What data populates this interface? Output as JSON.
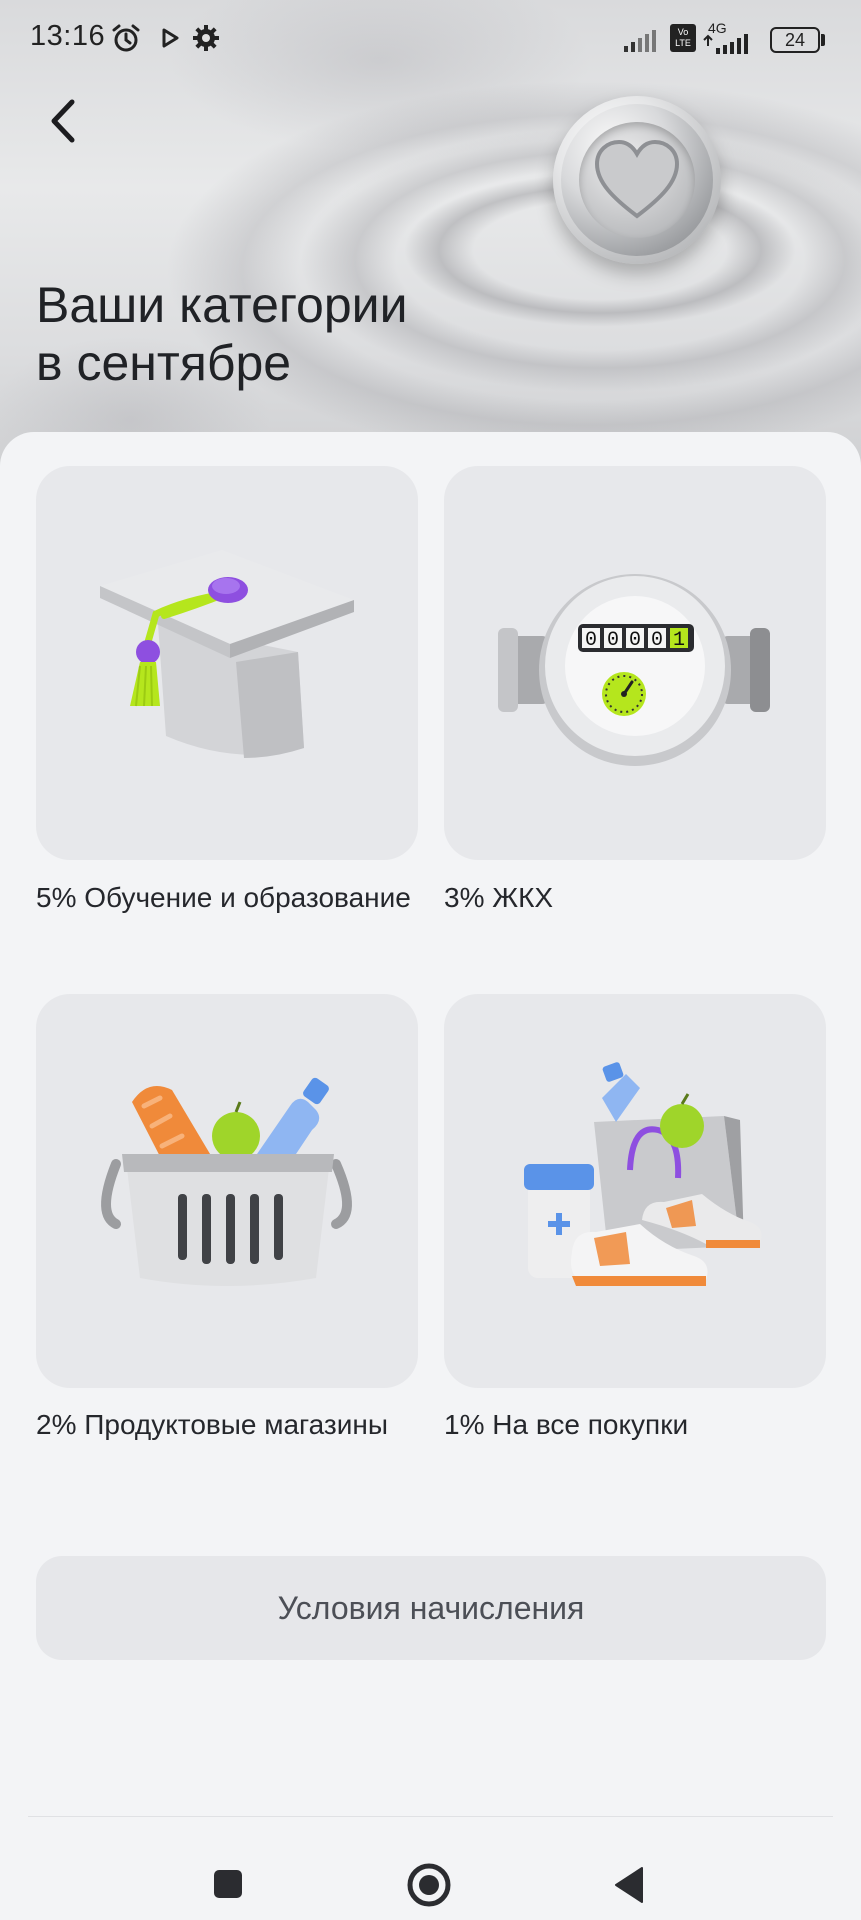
{
  "status_bar": {
    "time": "13:16",
    "battery": "24",
    "network": "4G",
    "volte": "Vo LTE"
  },
  "header": {
    "title_line1": "Ваши категории",
    "title_line2": "в сентябре"
  },
  "categories": [
    {
      "label": "5% Обучение и образование",
      "icon": "graduation-cap-icon"
    },
    {
      "label": "3% ЖКХ",
      "icon": "utility-meter-icon",
      "meter_reading": "00001"
    },
    {
      "label": "2% Продуктовые магазины",
      "icon": "grocery-basket-icon"
    },
    {
      "label": "1% На все покупки",
      "icon": "shopping-bag-icon"
    }
  ],
  "conditions_button": "Условия начисления",
  "colors": {
    "background": "#f2f3f5",
    "card": "#e7e8eb",
    "accent_purple": "#8e4fe0",
    "accent_lime": "#b5e61d",
    "accent_orange": "#f08a3a",
    "accent_blue": "#5a93e8"
  }
}
